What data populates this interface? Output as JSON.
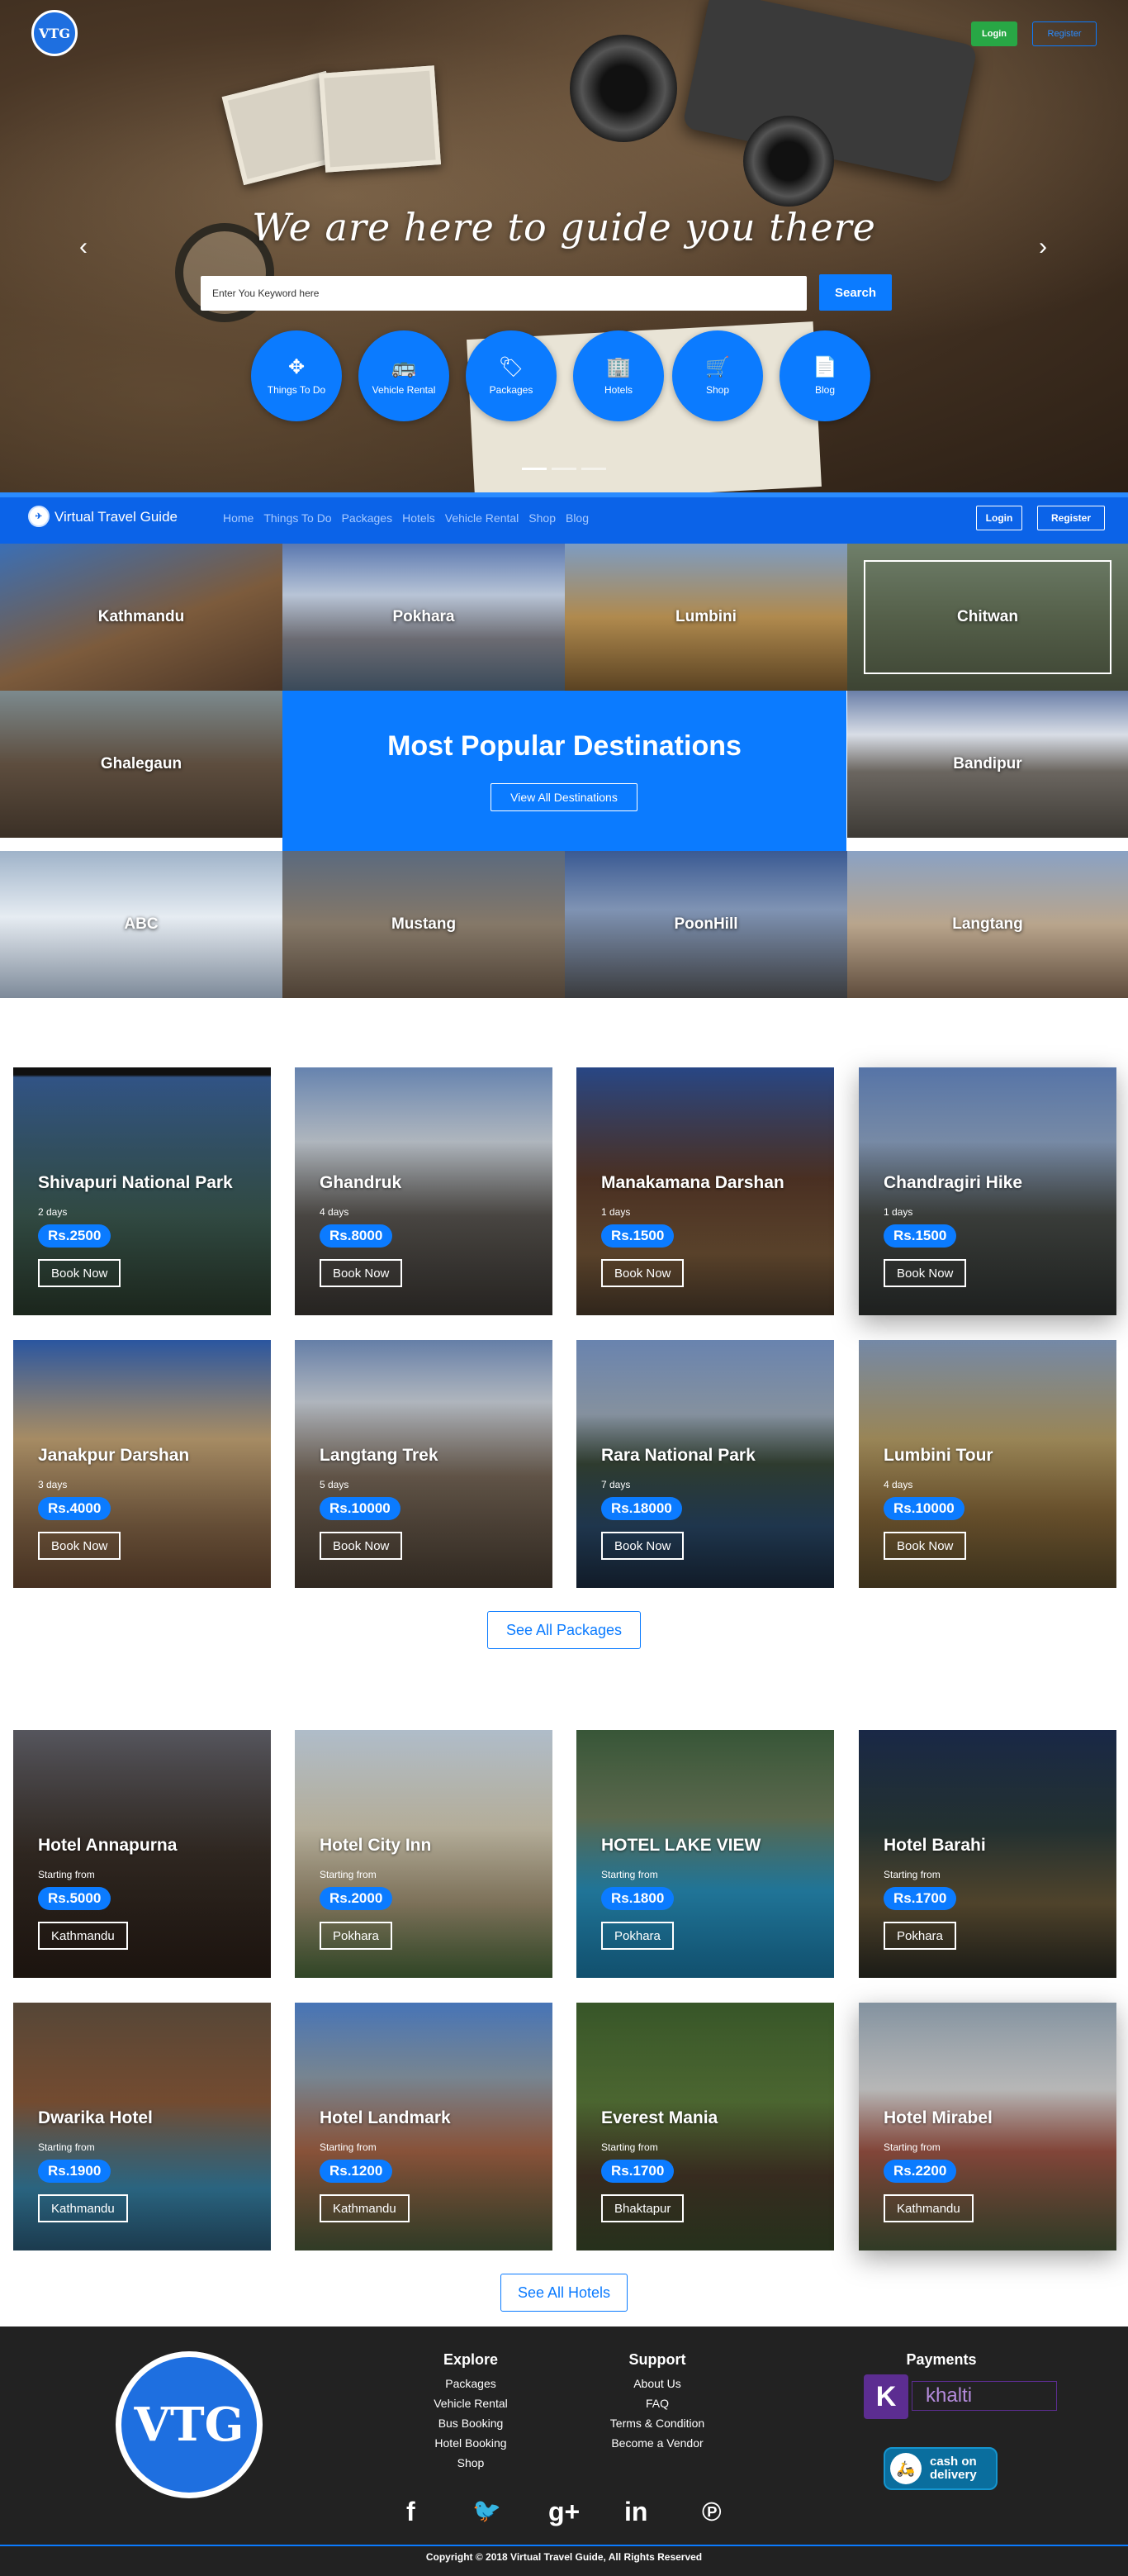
{
  "hero": {
    "logo_text": "VTG",
    "login": "Login",
    "register": "Register",
    "title": "We are here to guide you there",
    "search_placeholder": "Enter You Keyword here",
    "search_button": "Search",
    "prev_arrow": "‹",
    "next_arrow": "›",
    "categories": [
      {
        "label": "Things To Do",
        "icon": "compass-icon",
        "glyph": "✥"
      },
      {
        "label": "Vehicle Rental",
        "icon": "bus-icon",
        "glyph": "🚌"
      },
      {
        "label": "Packages",
        "icon": "tag-icon",
        "glyph": "🏷"
      },
      {
        "label": "Hotels",
        "icon": "building-icon",
        "glyph": "🏢"
      },
      {
        "label": "Shop",
        "icon": "cart-icon",
        "glyph": "🛒"
      },
      {
        "label": "Blog",
        "icon": "document-icon",
        "glyph": "📄"
      }
    ]
  },
  "navbar": {
    "title": "Virtual Travel Guide",
    "links": [
      "Home",
      "Things To Do",
      "Packages",
      "Hotels",
      "Vehicle Rental",
      "Shop",
      "Blog"
    ],
    "login": "Login",
    "register": "Register"
  },
  "destinations": {
    "row1": [
      "Kathmandu",
      "Pokhara",
      "Lumbini",
      "Chitwan"
    ],
    "row2": [
      "Ghalegaun",
      "Bandipur"
    ],
    "row3": [
      "ABC",
      "Mustang",
      "PoonHill",
      "Langtang"
    ],
    "popular_title": "Most Popular Destinations",
    "view_all": "View All Destinations"
  },
  "packages": {
    "items": [
      {
        "name": "Shivapuri National Park",
        "duration": "2 days",
        "price": "Rs.2500",
        "button": "Book Now"
      },
      {
        "name": "Ghandruk",
        "duration": "4 days",
        "price": "Rs.8000",
        "button": "Book Now"
      },
      {
        "name": "Manakamana Darshan",
        "duration": "1 days",
        "price": "Rs.1500",
        "button": "Book Now"
      },
      {
        "name": "Chandragiri Hike",
        "duration": "1 days",
        "price": "Rs.1500",
        "button": "Book Now"
      },
      {
        "name": "Janakpur Darshan",
        "duration": "3 days",
        "price": "Rs.4000",
        "button": "Book Now"
      },
      {
        "name": "Langtang Trek",
        "duration": "5 days",
        "price": "Rs.10000",
        "button": "Book Now"
      },
      {
        "name": "Rara National Park",
        "duration": "7 days",
        "price": "Rs.18000",
        "button": "Book Now"
      },
      {
        "name": "Lumbini Tour",
        "duration": "4 days",
        "price": "Rs.10000",
        "button": "Book Now"
      }
    ],
    "see_all": "See All Packages"
  },
  "hotels": {
    "starting_from": "Starting from",
    "items": [
      {
        "name": "Hotel Annapurna",
        "price": "Rs.5000",
        "location": "Kathmandu"
      },
      {
        "name": "Hotel City Inn",
        "price": "Rs.2000",
        "location": "Pokhara"
      },
      {
        "name": "HOTEL LAKE VIEW",
        "price": "Rs.1800",
        "location": "Pokhara"
      },
      {
        "name": "Hotel Barahi",
        "price": "Rs.1700",
        "location": "Pokhara"
      },
      {
        "name": "Dwarika Hotel",
        "price": "Rs.1900",
        "location": "Kathmandu"
      },
      {
        "name": "Hotel Landmark",
        "price": "Rs.1200",
        "location": "Kathmandu"
      },
      {
        "name": "Everest Mania",
        "price": "Rs.1700",
        "location": "Bhaktapur"
      },
      {
        "name": "Hotel Mirabel",
        "price": "Rs.2200",
        "location": "Kathmandu"
      }
    ],
    "see_all": "See All Hotels"
  },
  "footer": {
    "logo_text": "VTG",
    "explore": {
      "heading": "Explore",
      "items": [
        "Packages",
        "Vehicle Rental",
        "Bus Booking",
        "Hotel Booking",
        "Shop"
      ]
    },
    "support": {
      "heading": "Support",
      "items": [
        "About Us",
        "FAQ",
        "Terms & Condition",
        "Become a Vendor"
      ]
    },
    "payments": {
      "heading": "Payments",
      "khalti_k": "K",
      "khalti": "khalti",
      "cod_line1": "cash on",
      "cod_line2": "delivery"
    },
    "social": [
      {
        "icon": "facebook-icon",
        "glyph": "f"
      },
      {
        "icon": "twitter-icon",
        "glyph": "🐦"
      },
      {
        "icon": "google-plus-icon",
        "glyph": "g+"
      },
      {
        "icon": "linkedin-icon",
        "glyph": "in"
      },
      {
        "icon": "pinterest-icon",
        "glyph": "℗"
      }
    ],
    "copyright": "Copyright © 2018 Virtual Travel Guide, All Rights Reserved"
  }
}
